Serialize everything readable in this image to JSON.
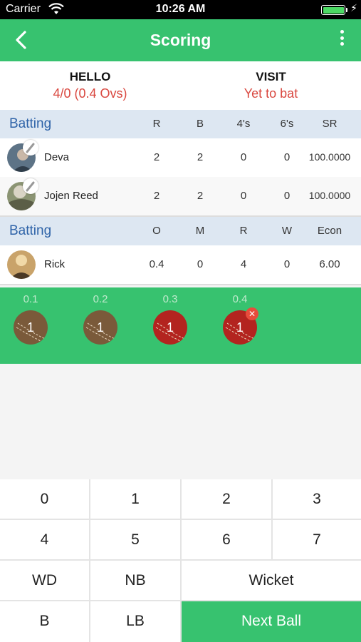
{
  "status_bar": {
    "carrier": "Carrier",
    "time": "10:26 AM"
  },
  "navbar": {
    "title": "Scoring"
  },
  "teams": [
    {
      "name": "HELLO",
      "score": "4/0 (0.4 Ovs)"
    },
    {
      "name": "VISIT",
      "score": "Yet to bat"
    }
  ],
  "batting": {
    "header": "Batting",
    "columns": [
      "R",
      "B",
      "4's",
      "6's",
      "SR"
    ],
    "rows": [
      {
        "name": "Deva",
        "r": "2",
        "b": "2",
        "fours": "0",
        "sixes": "0",
        "sr": "100.0000"
      },
      {
        "name": "Jojen Reed",
        "r": "2",
        "b": "2",
        "fours": "0",
        "sixes": "0",
        "sr": "100.0000"
      }
    ]
  },
  "bowling": {
    "header": "Batting",
    "columns": [
      "O",
      "M",
      "R",
      "W",
      "Econ"
    ],
    "rows": [
      {
        "name": "Rick",
        "o": "0.4",
        "m": "0",
        "r": "4",
        "w": "0",
        "econ": "6.00"
      }
    ]
  },
  "overs": [
    {
      "ball": "0.1",
      "runs": "1",
      "color": "#7a5a3a",
      "cancel": false
    },
    {
      "ball": "0.2",
      "runs": "1",
      "color": "#7a5a3a",
      "cancel": false
    },
    {
      "ball": "0.3",
      "runs": "1",
      "color": "#b3241f",
      "cancel": false
    },
    {
      "ball": "0.4",
      "runs": "1",
      "color": "#b3241f",
      "cancel": true
    }
  ],
  "keypad": {
    "k0": "0",
    "k1": "1",
    "k2": "2",
    "k3": "3",
    "k4": "4",
    "k5": "5",
    "k6": "6",
    "k7": "7",
    "wd": "WD",
    "nb": "NB",
    "wicket": "Wicket",
    "b": "B",
    "lb": "LB",
    "next_ball": "Next Ball"
  },
  "colors": {
    "accent": "#37c26f",
    "score_red": "#d9473f",
    "header_blue": "#2e63a8",
    "header_bg": "#dde7f2"
  },
  "icons": {
    "back": "chevron-left-icon",
    "more": "more-vertical-icon",
    "cancel": "close-icon"
  }
}
